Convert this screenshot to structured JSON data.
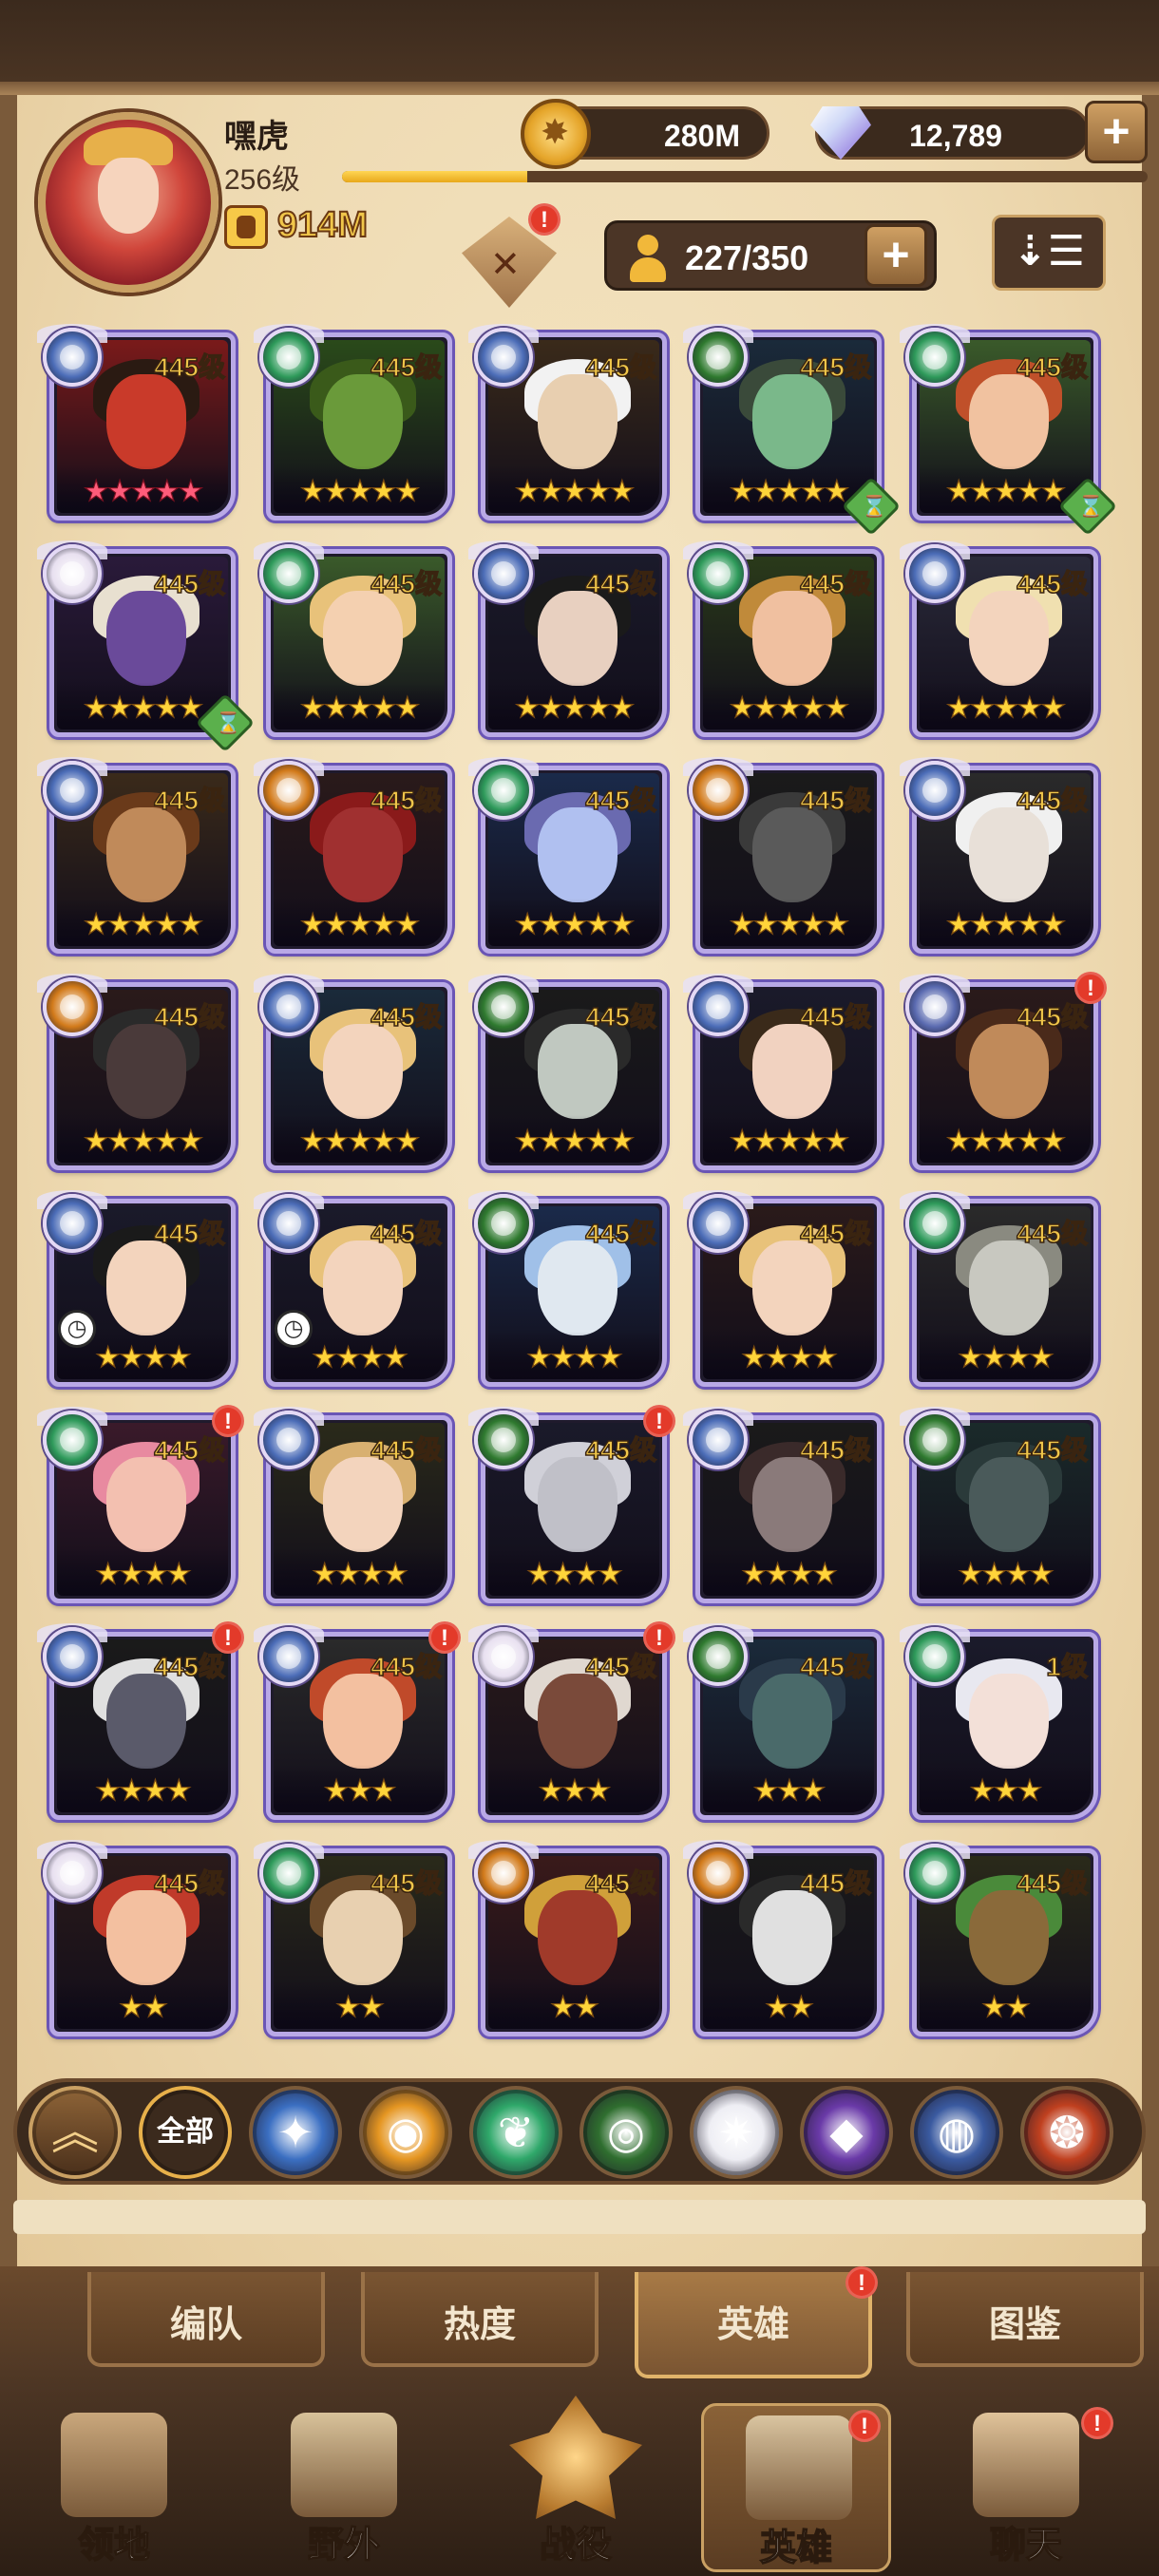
{
  "player": {
    "name": "嘿虎",
    "level": "256级",
    "xp_fraction": 0.23,
    "power": "914M"
  },
  "resources": {
    "gold": "280M",
    "gems": "12,789",
    "plus": "+"
  },
  "roster": {
    "count": "227/350",
    "plus": "+",
    "sort_icon": "sort-icon"
  },
  "alert_mark": "!",
  "heroes": [
    {
      "level": "445级",
      "stars": "★★★★★",
      "star_color": "pink",
      "faction": "lightbearer",
      "hue": "#7a1a1a",
      "skin": "#c93a2a",
      "hair": "#2a1a12"
    },
    {
      "level": "445级",
      "stars": "★★★★★",
      "star_color": "gold",
      "faction": "wilder",
      "hue": "#2a4a1a",
      "skin": "#6a9a3a",
      "hair": "#3a5a1a"
    },
    {
      "level": "445级",
      "stars": "★★★★★",
      "star_color": "gold",
      "faction": "lightbearer",
      "hue": "#3a2a1a",
      "skin": "#e8cfb0",
      "hair": "#f2f2f2"
    },
    {
      "level": "445级",
      "stars": "★★★★★",
      "star_color": "gold",
      "faction": "graveborn",
      "hue": "#1a2a3a",
      "skin": "#7ab88a",
      "hair": "#3a4a3a",
      "hourglass": true
    },
    {
      "level": "445级",
      "stars": "★★★★★",
      "star_color": "gold",
      "faction": "wilder",
      "hue": "#3a5a2a",
      "skin": "#f1c2a0",
      "hair": "#c0502a",
      "hourglass": true
    },
    {
      "level": "445级",
      "stars": "★★★★★",
      "star_color": "gold",
      "faction": "celestial",
      "hue": "#2a1a3a",
      "skin": "#6a4a9a",
      "hair": "#e8e0d0",
      "hourglass": true
    },
    {
      "level": "445级",
      "stars": "★★★★★",
      "star_color": "gold",
      "faction": "wilder",
      "hue": "#3a5a2a",
      "skin": "#f4d0b0",
      "hair": "#e8c27a"
    },
    {
      "level": "445级",
      "stars": "★★★★★",
      "star_color": "gold",
      "faction": "lightbearer",
      "hue": "#1a1a2a",
      "skin": "#e8d0c0",
      "hair": "#1a1a1a"
    },
    {
      "level": "445级",
      "stars": "★★★★★",
      "star_color": "gold",
      "faction": "wilder",
      "hue": "#2a3a1a",
      "skin": "#f0c0a0",
      "hair": "#c08a3a"
    },
    {
      "level": "445级",
      "stars": "★★★★★",
      "star_color": "gold",
      "faction": "lightbearer",
      "hue": "#2a2a3a",
      "skin": "#f3d4bd",
      "hair": "#f0e0b0"
    },
    {
      "level": "445级",
      "stars": "★★★★★",
      "star_color": "gold",
      "faction": "lightbearer",
      "hue": "#3a2a1a",
      "skin": "#c08a5a",
      "hair": "#6a3a1a"
    },
    {
      "level": "445级",
      "stars": "★★★★★",
      "star_color": "gold",
      "faction": "mauler",
      "hue": "#2a1a1a",
      "skin": "#a03030",
      "hair": "#8a1a1a"
    },
    {
      "level": "445级",
      "stars": "★★★★★",
      "star_color": "gold",
      "faction": "wilder",
      "hue": "#1a2a4a",
      "skin": "#b0c0f0",
      "hair": "#6a6ab0"
    },
    {
      "level": "445级",
      "stars": "★★★★★",
      "star_color": "gold",
      "faction": "mauler",
      "hue": "#1a1a1a",
      "skin": "#5a5a5a",
      "hair": "#3a3a3a"
    },
    {
      "level": "445级",
      "stars": "★★★★★",
      "star_color": "gold",
      "faction": "lightbearer",
      "hue": "#2a2a2a",
      "skin": "#e8e0d8",
      "hair": "#f0f0f0"
    },
    {
      "level": "445级",
      "stars": "★★★★★",
      "star_color": "gold",
      "faction": "mauler",
      "hue": "#2a1a1a",
      "skin": "#4a3a3a",
      "hair": "#2a2a2a"
    },
    {
      "level": "445级",
      "stars": "★★★★★",
      "star_color": "gold",
      "faction": "lightbearer",
      "hue": "#1a2a3a",
      "skin": "#f3d4bd",
      "hair": "#e8c27a"
    },
    {
      "level": "445级",
      "stars": "★★★★★",
      "star_color": "gold",
      "faction": "graveborn",
      "hue": "#1a1a1a",
      "skin": "#c0c8c0",
      "hair": "#2a2a2a"
    },
    {
      "level": "445级",
      "stars": "★★★★★",
      "star_color": "gold",
      "faction": "lightbearer",
      "hue": "#1a1a2a",
      "skin": "#f1d2c0",
      "hair": "#3a2a1a"
    },
    {
      "level": "445级",
      "stars": "★★★★★",
      "star_color": "gold",
      "faction": "dimensional",
      "hue": "#2a1a1a",
      "skin": "#c08a5a",
      "hair": "#4a2a1a",
      "alert": true
    },
    {
      "level": "445级",
      "stars": "★★★★",
      "star_color": "gold",
      "faction": "lightbearer",
      "hue": "#1a1a2a",
      "skin": "#f3d4bd",
      "hair": "#1a1a1a",
      "timer": true
    },
    {
      "level": "445级",
      "stars": "★★★★",
      "star_color": "gold",
      "faction": "lightbearer",
      "hue": "#1a1a2a",
      "skin": "#f3d4bd",
      "hair": "#e8c27a",
      "timer": true
    },
    {
      "level": "445级",
      "stars": "★★★★",
      "star_color": "gold",
      "faction": "graveborn",
      "hue": "#1a2a4a",
      "skin": "#e0e8f0",
      "hair": "#a0c0e8"
    },
    {
      "level": "445级",
      "stars": "★★★★",
      "star_color": "gold",
      "faction": "lightbearer",
      "hue": "#2a1a1a",
      "skin": "#f3d4bd",
      "hair": "#e8c27a"
    },
    {
      "level": "445级",
      "stars": "★★★★",
      "star_color": "gold",
      "faction": "wilder",
      "hue": "#2a2a2a",
      "skin": "#c8c8c0",
      "hair": "#8a8a80"
    },
    {
      "level": "445级",
      "stars": "★★★★",
      "star_color": "gold",
      "faction": "wilder",
      "hue": "#3a1a2a",
      "skin": "#f3c0b0",
      "hair": "#e88aa0",
      "alert": true
    },
    {
      "level": "445级",
      "stars": "★★★★",
      "star_color": "gold",
      "faction": "lightbearer",
      "hue": "#2a2a1a",
      "skin": "#f3d4bd",
      "hair": "#d8b070"
    },
    {
      "level": "445级",
      "stars": "★★★★",
      "star_color": "gold",
      "faction": "graveborn",
      "hue": "#1a1a2a",
      "skin": "#c0c0c8",
      "hair": "#d0d0d8",
      "alert": true
    },
    {
      "level": "445级",
      "stars": "★★★★",
      "star_color": "gold",
      "faction": "lightbearer",
      "hue": "#1a1a1a",
      "skin": "#8a7a7a",
      "hair": "#3a2a2a"
    },
    {
      "level": "445级",
      "stars": "★★★★",
      "star_color": "gold",
      "faction": "graveborn",
      "hue": "#1a2a2a",
      "skin": "#4a5a5a",
      "hair": "#2a3a3a"
    },
    {
      "level": "445级",
      "stars": "★★★★",
      "star_color": "gold",
      "faction": "lightbearer",
      "hue": "#1a1a1a",
      "skin": "#5a5a6a",
      "hair": "#e0e0e0",
      "alert": true
    },
    {
      "level": "445级",
      "stars": "★★★",
      "star_color": "gold",
      "faction": "lightbearer",
      "hue": "#2a2a2a",
      "skin": "#f3c0a0",
      "hair": "#c04a2a",
      "alert": true
    },
    {
      "level": "445级",
      "stars": "★★★",
      "star_color": "gold",
      "faction": "celestial",
      "hue": "#2a1a1a",
      "skin": "#7a4a3a",
      "hair": "#e0d8d0",
      "alert": true
    },
    {
      "level": "445级",
      "stars": "★★★",
      "star_color": "gold",
      "faction": "graveborn",
      "hue": "#1a2a3a",
      "skin": "#4a6a6a",
      "hair": "#2a3a4a"
    },
    {
      "level": "1级",
      "stars": "★★★",
      "star_color": "gold",
      "faction": "wilder",
      "hue": "#1a1a2a",
      "skin": "#f3e0d8",
      "hair": "#e8e8f0"
    },
    {
      "level": "445级",
      "stars": "★★",
      "star_color": "gold",
      "faction": "celestial",
      "hue": "#2a1a1a",
      "skin": "#f3c0a0",
      "hair": "#c03a2a"
    },
    {
      "level": "445级",
      "stars": "★★",
      "star_color": "gold",
      "faction": "wilder",
      "hue": "#2a2a1a",
      "skin": "#e8d0b0",
      "hair": "#6a4a2a"
    },
    {
      "level": "445级",
      "stars": "★★",
      "star_color": "gold",
      "faction": "mauler",
      "hue": "#3a1a1a",
      "skin": "#a03a2a",
      "hair": "#d0a03a"
    },
    {
      "level": "445级",
      "stars": "★★",
      "star_color": "gold",
      "faction": "mauler",
      "hue": "#1a1a1a",
      "skin": "#e0e0e0",
      "hair": "#2a2a2a"
    },
    {
      "level": "445级",
      "stars": "★★",
      "star_color": "gold",
      "faction": "wilder",
      "hue": "#2a2a1a",
      "skin": "#8a6a3a",
      "hair": "#4a8a3a"
    }
  ],
  "faction_colors": {
    "lightbearer": "#4b6cb7",
    "wilder": "#2e9a5a",
    "graveborn": "#2f7a2f",
    "mauler": "#d27a1a",
    "celestial": "#e8e0f0",
    "dimensional": "#5a6ab0"
  },
  "filters": [
    {
      "name": "filter-collapse",
      "glyph": "︽",
      "bg": "up"
    },
    {
      "name": "filter-all",
      "label": "全部",
      "bg": "all"
    },
    {
      "name": "filter-lightbearer",
      "glyph": "✦",
      "color": "#3b6fc2"
    },
    {
      "name": "filter-mauler",
      "glyph": "◉",
      "color": "#e59622"
    },
    {
      "name": "filter-wilder",
      "glyph": "❦",
      "color": "#2fa86a"
    },
    {
      "name": "filter-graveborn",
      "glyph": "◎",
      "color": "#2f6e2f"
    },
    {
      "name": "filter-celestial",
      "glyph": "✷",
      "color": "#eeeef4"
    },
    {
      "name": "filter-hypogean",
      "glyph": "◆",
      "color": "#6a3aa8"
    },
    {
      "name": "filter-dimensional",
      "glyph": "◍",
      "color": "#3a5aa0"
    },
    {
      "name": "filter-draconis",
      "glyph": "❂",
      "color": "#c0401f"
    }
  ],
  "tabs": [
    {
      "label": "编队"
    },
    {
      "label": "热度"
    },
    {
      "label": "英雄",
      "active": true,
      "alert": true
    },
    {
      "label": "图鉴"
    }
  ],
  "nav": [
    {
      "label": "领地",
      "icon": "castle-icon"
    },
    {
      "label": "野外",
      "icon": "map-scroll-icon"
    },
    {
      "label": "战役",
      "icon": "campaign-emblem-icon"
    },
    {
      "label": "英雄",
      "icon": "hero-helmet-icon",
      "active": true,
      "alert": true
    },
    {
      "label": "聊天",
      "icon": "chat-bubble-icon",
      "alert": true
    }
  ]
}
